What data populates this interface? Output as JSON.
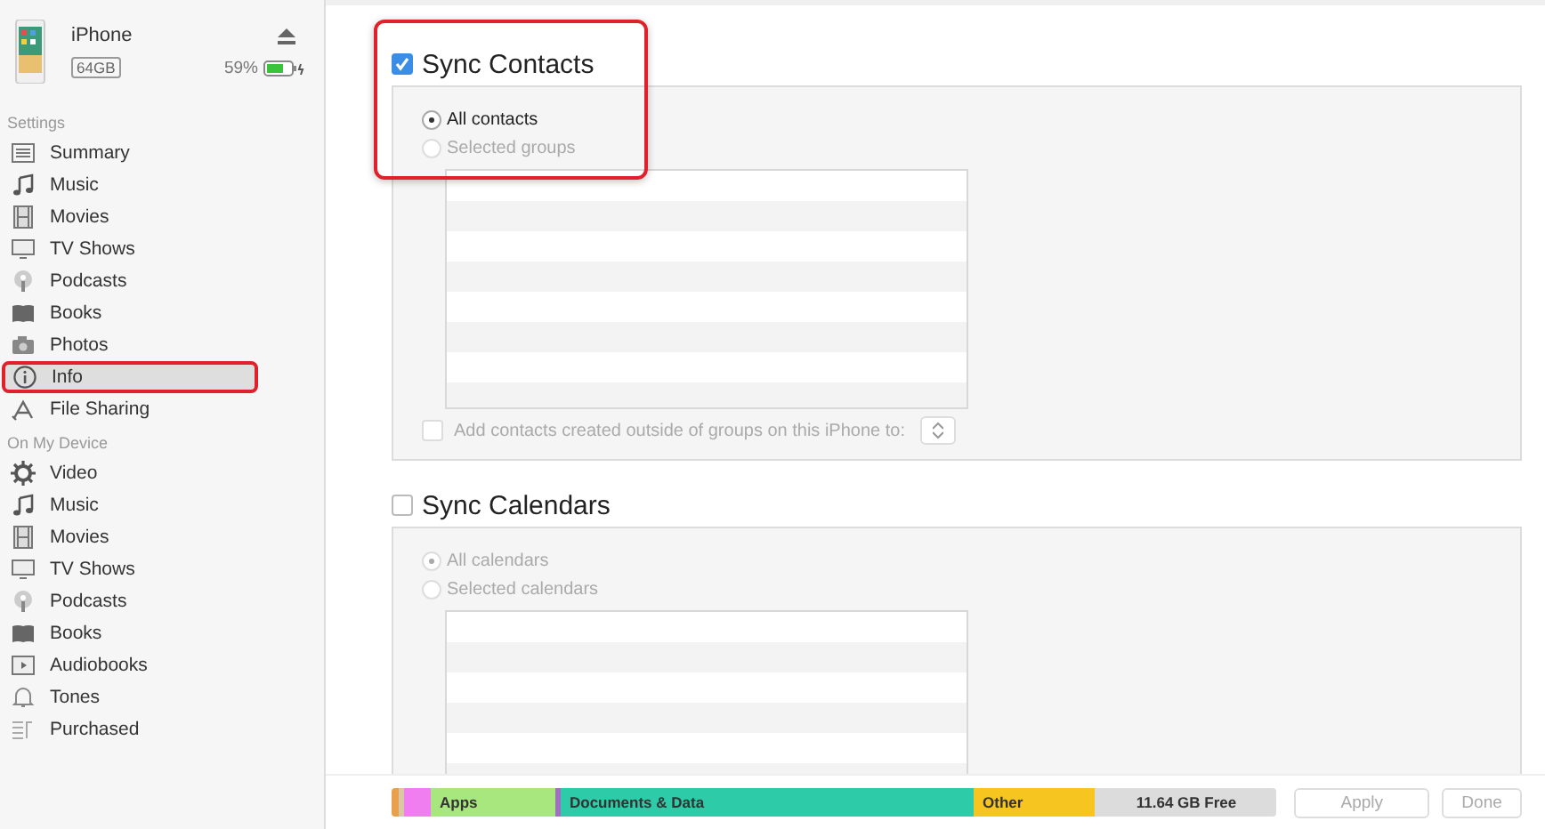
{
  "device": {
    "name": "iPhone",
    "capacity": "64GB",
    "battery": "59%"
  },
  "sidebar": {
    "sections": [
      {
        "title": "Settings",
        "items": [
          {
            "label": "Summary",
            "selected": false,
            "highlighted": false
          },
          {
            "label": "Music",
            "selected": false,
            "highlighted": false
          },
          {
            "label": "Movies",
            "selected": false,
            "highlighted": false
          },
          {
            "label": "TV Shows",
            "selected": false,
            "highlighted": false
          },
          {
            "label": "Podcasts",
            "selected": false,
            "highlighted": false
          },
          {
            "label": "Books",
            "selected": false,
            "highlighted": false
          },
          {
            "label": "Photos",
            "selected": false,
            "highlighted": false
          },
          {
            "label": "Info",
            "selected": true,
            "highlighted": true
          },
          {
            "label": "File Sharing",
            "selected": false,
            "highlighted": false
          }
        ]
      },
      {
        "title": "On My Device",
        "items": [
          {
            "label": "Video",
            "selected": false,
            "highlighted": false
          },
          {
            "label": "Music",
            "selected": false,
            "highlighted": false
          },
          {
            "label": "Movies",
            "selected": false,
            "highlighted": false
          },
          {
            "label": "TV Shows",
            "selected": false,
            "highlighted": false
          },
          {
            "label": "Podcasts",
            "selected": false,
            "highlighted": false
          },
          {
            "label": "Books",
            "selected": false,
            "highlighted": false
          },
          {
            "label": "Audiobooks",
            "selected": false,
            "highlighted": false
          },
          {
            "label": "Tones",
            "selected": false,
            "highlighted": false
          },
          {
            "label": "Purchased",
            "selected": false,
            "highlighted": false
          }
        ]
      }
    ]
  },
  "sync_sections": [
    {
      "title": "Sync Contacts",
      "checked": true,
      "highlighted": true,
      "options": [
        {
          "label": "All contacts",
          "selected": true,
          "disabled": false
        },
        {
          "label": "Selected groups",
          "selected": false,
          "disabled": true
        }
      ],
      "extra_option": {
        "label": "Add contacts created outside of groups on this iPhone to:",
        "checked": false,
        "disabled": true
      }
    },
    {
      "title": "Sync Calendars",
      "checked": false,
      "highlighted": false,
      "options": [
        {
          "label": "All calendars",
          "selected": true,
          "disabled": true
        },
        {
          "label": "Selected calendars",
          "selected": false,
          "disabled": true
        }
      ]
    }
  ],
  "storage": {
    "segments": [
      {
        "color": "#e8a04a"
      },
      {
        "color": "#d8c8a8"
      },
      {
        "color": "#f07ef0"
      },
      {
        "label": "Apps",
        "color": "#a8e67e"
      },
      {
        "color": "#a070c0"
      },
      {
        "label": "Documents & Data",
        "color": "#2ecba8"
      },
      {
        "label": "Other",
        "color": "#f7c520"
      },
      {
        "label": "11.64 GB Free",
        "color": "#dcdcdc"
      }
    ]
  },
  "buttons": [
    {
      "label": "Apply",
      "disabled": true
    },
    {
      "label": "Done",
      "disabled": true
    }
  ]
}
